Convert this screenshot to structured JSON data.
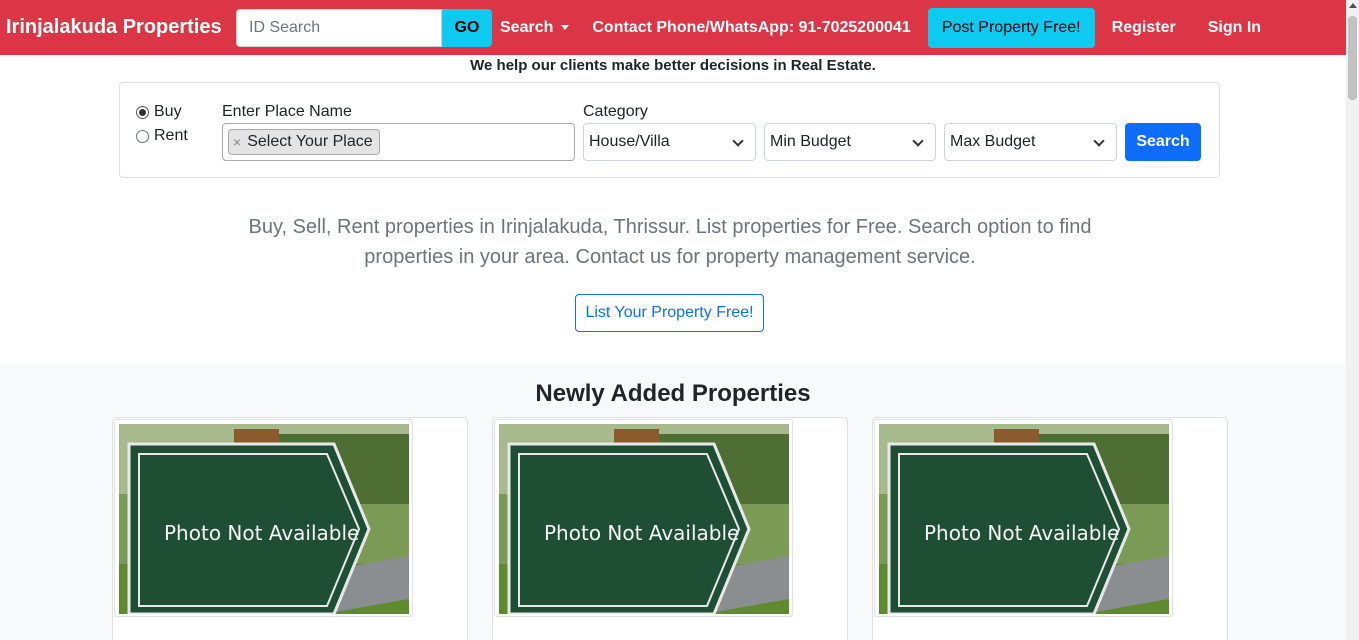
{
  "navbar": {
    "brand": "Irinjalakuda Properties",
    "id_search_placeholder": "ID Search",
    "go_label": "GO",
    "search_label": "Search",
    "contact": "Contact Phone/WhatsApp: 91-7025200041",
    "post_label": "Post Property Free!",
    "register_label": "Register",
    "signin_label": "Sign In",
    "colors": {
      "navbar": "#dc3545",
      "accent_cyan": "#0dcaf0"
    }
  },
  "tagline": "We help our clients make better decisions in Real Estate.",
  "search_form": {
    "buy_label": "Buy",
    "rent_label": "Rent",
    "selected_mode": "Buy",
    "place_label": "Enter Place Name",
    "place_chip": "Select Your Place",
    "category_label": "Category",
    "category_value": "House/Villa",
    "min_budget": "Min Budget",
    "max_budget": "Max Budget",
    "search_label": "Search"
  },
  "lead_text": "Buy, Sell, Rent properties in Irinjalakuda, Thrissur. List properties for Free. Search option to find properties in your area. Contact us for property management service.",
  "list_button": "List Your Property Free!",
  "properties": {
    "title": "Newly Added Properties",
    "photo_text": "Photo Not Available"
  }
}
